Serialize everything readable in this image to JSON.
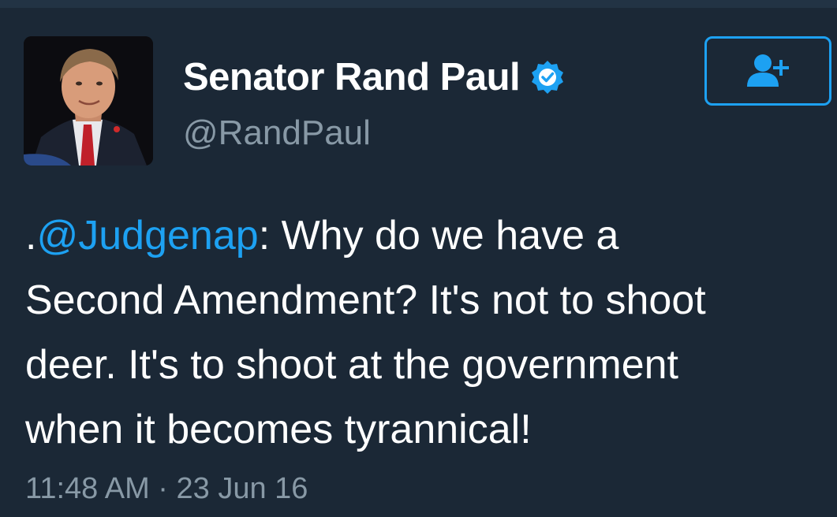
{
  "colors": {
    "background": "#1b2836",
    "text": "#ffffff",
    "muted": "#8899a6",
    "accent": "#1da1f2"
  },
  "author": {
    "display_name": "Senator Rand Paul",
    "handle": "@RandPaul",
    "verified_icon": "verified-badge-icon",
    "avatar": "profile-photo"
  },
  "follow_button": {
    "icon": "add-user-icon"
  },
  "tweet": {
    "line1_prefix": ".",
    "mention": "@Judgenap",
    "line1_rest": ": Why do we have a",
    "line2": "Second Amendment? It's not to shoot",
    "line3": "deer. It's to shoot at the government",
    "line4": "when it becomes tyrannical!",
    "timestamp": "11:48 AM · 23 Jun 16"
  }
}
